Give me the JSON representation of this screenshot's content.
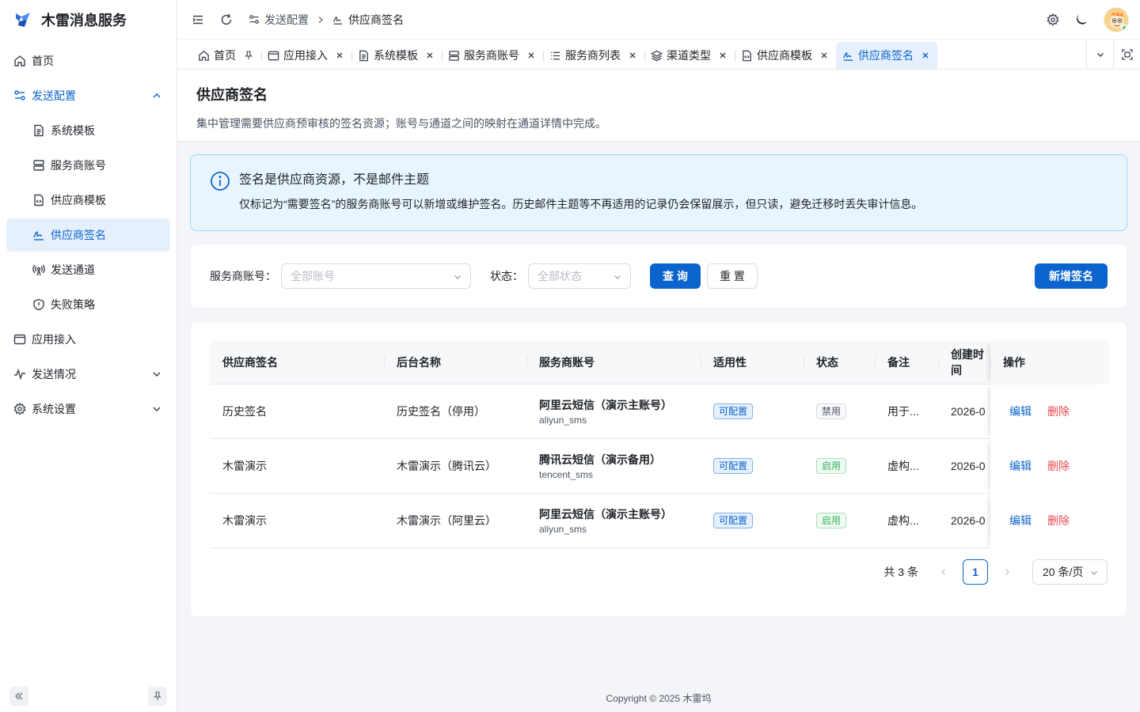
{
  "app": {
    "title": "木雷消息服务"
  },
  "sidebar": {
    "items": [
      {
        "label": "首页",
        "icon": "home-icon"
      },
      {
        "label": "发送配置",
        "icon": "config-icon"
      },
      {
        "label": "系统模板",
        "icon": "document-icon"
      },
      {
        "label": "服务商账号",
        "icon": "server-icon"
      },
      {
        "label": "供应商模板",
        "icon": "file-code-icon"
      },
      {
        "label": "供应商签名",
        "icon": "signature-icon"
      },
      {
        "label": "发送通道",
        "icon": "broadcast-icon"
      },
      {
        "label": "失败策略",
        "icon": "shield-icon"
      },
      {
        "label": "应用接入",
        "icon": "window-icon"
      },
      {
        "label": "发送情况",
        "icon": "activity-icon"
      },
      {
        "label": "系统设置",
        "icon": "gear-icon"
      }
    ]
  },
  "header": {
    "breadcrumb": [
      {
        "label": "发送配置"
      },
      {
        "label": "供应商签名"
      }
    ]
  },
  "tabs": [
    {
      "label": "首页",
      "icon": "home-icon"
    },
    {
      "label": "应用接入",
      "icon": "window-icon"
    },
    {
      "label": "系统模板",
      "icon": "document-icon"
    },
    {
      "label": "服务商账号",
      "icon": "server-icon"
    },
    {
      "label": "服务商列表",
      "icon": "list-icon"
    },
    {
      "label": "渠道类型",
      "icon": "layers-icon"
    },
    {
      "label": "供应商模板",
      "icon": "file-code-icon"
    },
    {
      "label": "供应商签名",
      "icon": "signature-icon"
    }
  ],
  "page": {
    "title": "供应商签名",
    "description": "集中管理需要供应商预审核的签名资源；账号与通道之间的映射在通道详情中完成。"
  },
  "alert": {
    "title": "签名是供应商资源，不是邮件主题",
    "description": "仅标记为“需要签名”的服务商账号可以新增或维护签名。历史邮件主题等不再适用的记录仍会保留展示，但只读，避免迁移时丢失审计信息。"
  },
  "filters": {
    "account_label": "服务商账号：",
    "account_placeholder": "全部账号",
    "status_label": "状态：",
    "status_placeholder": "全部状态",
    "query_label": "查 询",
    "reset_label": "重 置",
    "add_label": "新增签名"
  },
  "table": {
    "columns": [
      "供应商签名",
      "后台名称",
      "服务商账号",
      "适用性",
      "状态",
      "备注",
      "创建时间",
      "操作"
    ],
    "rows": [
      {
        "signature": "历史签名",
        "backend_name": "历史签名（停用）",
        "account_name": "阿里云短信（演示主账号）",
        "account_code": "aliyun_sms",
        "applicability": "可配置",
        "status": "禁用",
        "status_kind": "gray",
        "remark": "用于...",
        "created": "2026-0",
        "edit": "编辑",
        "delete": "删除"
      },
      {
        "signature": "木雷演示",
        "backend_name": "木雷演示（腾讯云）",
        "account_name": "腾讯云短信（演示备用）",
        "account_code": "tencent_sms",
        "applicability": "可配置",
        "status": "启用",
        "status_kind": "green",
        "remark": "虚构...",
        "created": "2026-0",
        "edit": "编辑",
        "delete": "删除"
      },
      {
        "signature": "木雷演示",
        "backend_name": "木雷演示（阿里云）",
        "account_name": "阿里云短信（演示主账号）",
        "account_code": "aliyun_sms",
        "applicability": "可配置",
        "status": "启用",
        "status_kind": "green",
        "remark": "虚构...",
        "created": "2026-0",
        "edit": "编辑",
        "delete": "删除"
      }
    ]
  },
  "pagination": {
    "total_text": "共 3 条",
    "current_page": "1",
    "page_size": "20 条/页"
  },
  "footer": {
    "copyright": "Copyright © 2025 木雷坞"
  },
  "colors": {
    "primary": "#0b63ce",
    "alert_bg": "#e8f5fd",
    "danger": "#e5484d",
    "success": "#34b35a"
  }
}
